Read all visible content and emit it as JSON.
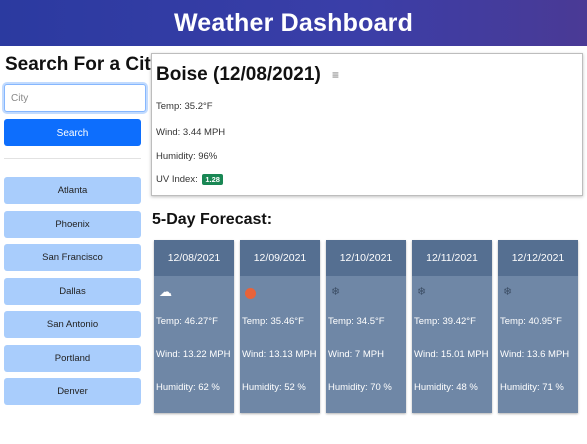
{
  "header": {
    "title": "Weather Dashboard"
  },
  "search": {
    "title": "Search For a City:",
    "placeholder": "City",
    "button_label": "Search"
  },
  "history": [
    {
      "label": "Atlanta"
    },
    {
      "label": "Phoenix"
    },
    {
      "label": "San Francisco"
    },
    {
      "label": "Dallas"
    },
    {
      "label": "San Antonio"
    },
    {
      "label": "Portland"
    },
    {
      "label": "Denver"
    }
  ],
  "current": {
    "title": "Boise (12/08/2021)",
    "icon": "mist-icon",
    "temp": "Temp: 35.2°F",
    "wind": "Wind: 3.44 MPH",
    "humidity": "Humidity: 96%",
    "uv_label": "UV Index:",
    "uv_value": "1.28",
    "uv_color": "#198754"
  },
  "forecast": {
    "title": "5-Day Forecast:",
    "days": [
      {
        "date": "12/08/2021",
        "icon": "partly-cloudy-icon",
        "temp": "Temp: 46.27°F",
        "wind": "Wind: 13.22 MPH",
        "humidity": "Humidity: 62 %"
      },
      {
        "date": "12/09/2021",
        "icon": "sun-icon",
        "temp": "Temp: 35.46°F",
        "wind": "Wind: 13.13 MPH",
        "humidity": "Humidity: 52 %"
      },
      {
        "date": "12/10/2021",
        "icon": "snow-icon",
        "temp": "Temp: 34.5°F",
        "wind": "Wind: 7 MPH",
        "humidity": "Humidity: 70 %"
      },
      {
        "date": "12/11/2021",
        "icon": "snow-icon",
        "temp": "Temp: 39.42°F",
        "wind": "Wind: 15.01 MPH",
        "humidity": "Humidity: 48 %"
      },
      {
        "date": "12/12/2021",
        "icon": "snow-icon",
        "temp": "Temp: 40.95°F",
        "wind": "Wind: 13.6 MPH",
        "humidity": "Humidity: 71 %"
      }
    ]
  },
  "colors": {
    "header": "#2b3aa0",
    "search_button": "#0d6efd",
    "history_button": "#a9cdfc",
    "forecast_card": "#6f87a6",
    "forecast_date": "#556f91"
  }
}
